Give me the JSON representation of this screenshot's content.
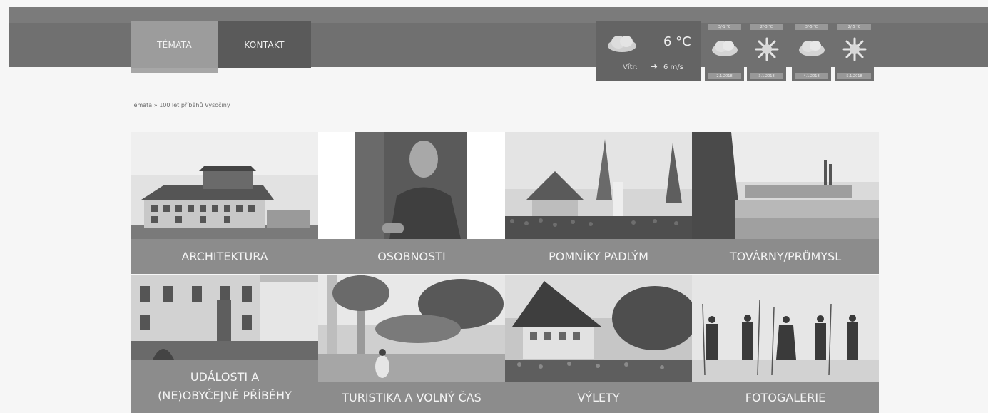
{
  "nav": {
    "items": [
      {
        "label": "TÉMATA"
      },
      {
        "label": "KONTAKT"
      }
    ]
  },
  "weather": {
    "current_temp": "6 °C",
    "wind_label": "Vítr:",
    "wind_speed": "6 m/s",
    "icon": "cloud-icon",
    "forecast": [
      {
        "temp": "3/-1 °C",
        "date": "2.1.2018",
        "icon": "cloud-icon"
      },
      {
        "temp": "2/-3 °C",
        "date": "3.1.2018",
        "icon": "snow-icon"
      },
      {
        "temp": "3/-5 °C",
        "date": "4.1.2018",
        "icon": "cloud-icon"
      },
      {
        "temp": "2/-5 °C",
        "date": "5.1.2018",
        "icon": "snow-icon"
      }
    ]
  },
  "breadcrumb": {
    "root": "Témata",
    "separator": "»",
    "current": "100 let příběhů Vysočiny"
  },
  "tiles": [
    {
      "label": "ARCHITEKTURA"
    },
    {
      "label": "OSOBNOSTI"
    },
    {
      "label": "POMNÍKY PADLÝM"
    },
    {
      "label": "TOVÁRNY/PRŮMYSL"
    },
    {
      "label_line1": "UDÁLOSTI A",
      "label_line2": "(NE)OBYČEJNÉ PŘÍBĚHY"
    },
    {
      "label": "TURISTIKA A VOLNÝ ČAS"
    },
    {
      "label": "VÝLETY"
    },
    {
      "label": "FOTOGALERIE"
    }
  ]
}
